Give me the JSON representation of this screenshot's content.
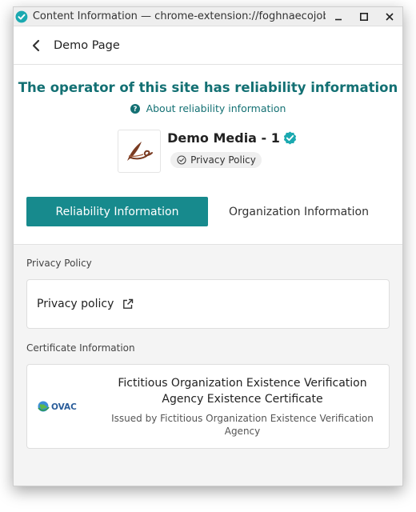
{
  "window": {
    "title": "Content Information — chrome-extension://foghnaecojob..."
  },
  "header": {
    "back_icon": "chevron-left-icon",
    "title": "Demo Page"
  },
  "headline": "The operator of this site has reliability information",
  "about_link": "About reliability information",
  "organization": {
    "name": "Demo Media - 1",
    "badge": "Privacy Policy"
  },
  "tabs": [
    {
      "label": "Reliability Information",
      "active": true
    },
    {
      "label": "Organization Information",
      "active": false
    }
  ],
  "sections": {
    "privacy_label": "Privacy Policy",
    "privacy_link": "Privacy policy",
    "certificate_label": "Certificate Information"
  },
  "certificate": {
    "logo_text": "OVAC",
    "title": "Fictitious Organization Existence Verification Agency Existence Certificate",
    "issuer": "Issued by Fictitious Organization Existence Verification Agency"
  },
  "colors": {
    "accent": "#137073",
    "tab_active": "#178a8d",
    "verified": "#1aa9b0"
  }
}
